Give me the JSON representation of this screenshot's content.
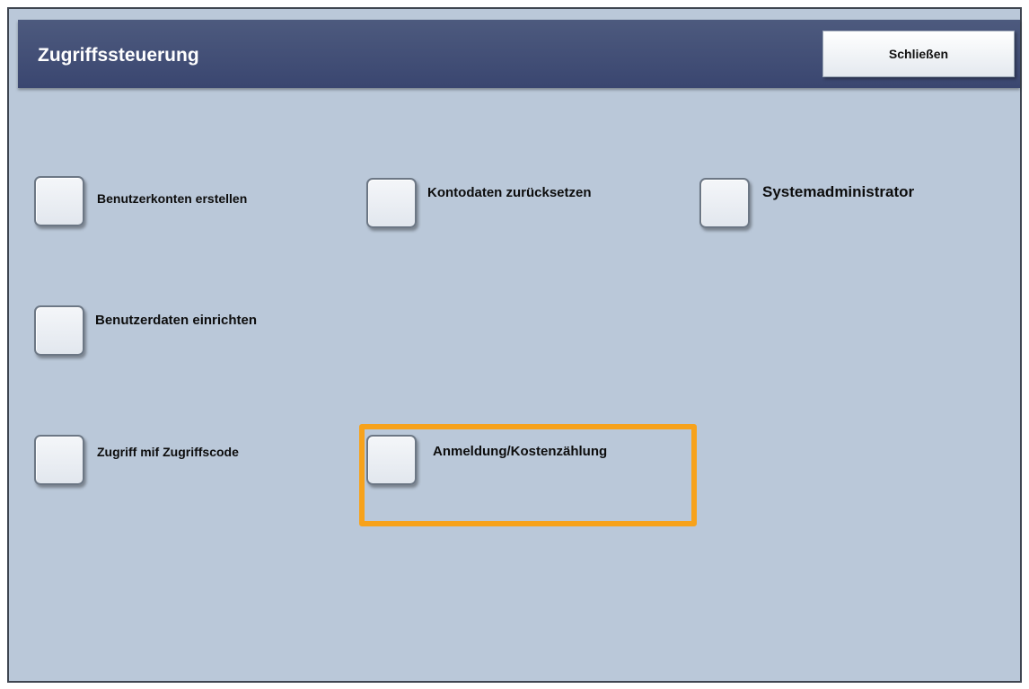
{
  "window": {
    "title": "Zugriffssteuerung",
    "close_label": "Schließen"
  },
  "options": [
    {
      "label": "Benutzerkonten erstellen"
    },
    {
      "label": "Kontodaten zurücksetzen"
    },
    {
      "label": "Systemadministrator"
    },
    {
      "label": "Benutzerdaten einrichten"
    },
    {
      "label": "Zugriff mif Zugriffscode"
    },
    {
      "label": "Anmeldung/Kostenzählung",
      "highlighted": true
    }
  ],
  "colors": {
    "background": "#bac8d9",
    "title_bar": "#3f4a72",
    "highlight": "#f7a21b"
  }
}
